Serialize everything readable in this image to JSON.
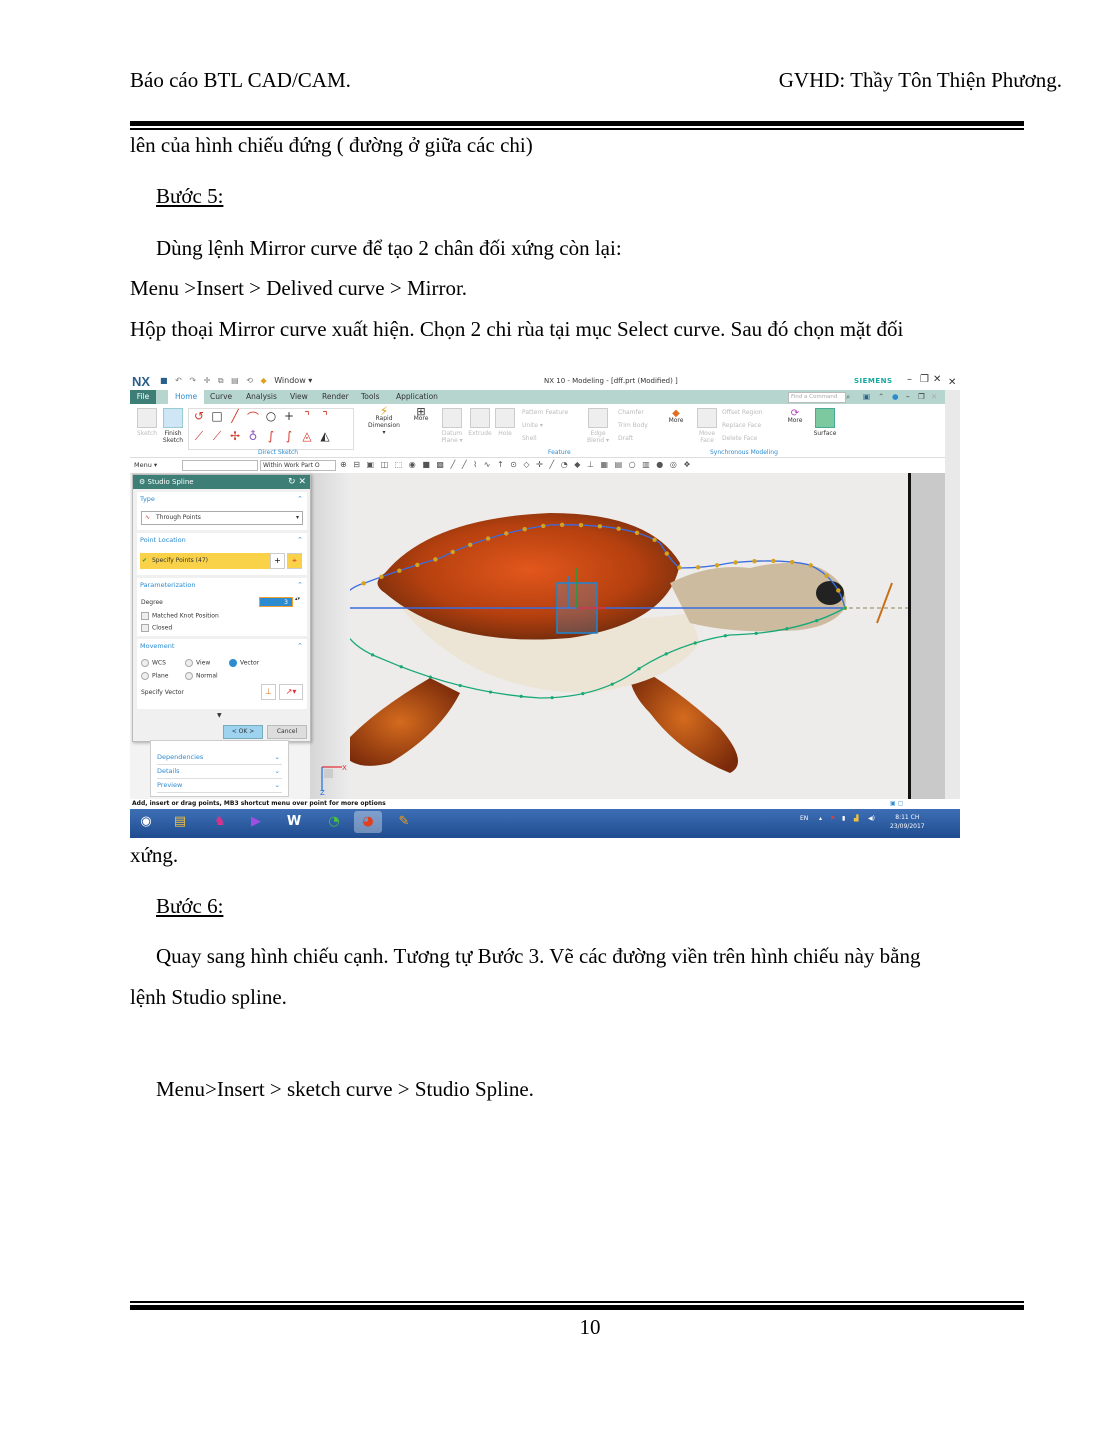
{
  "header": {
    "left": "Báo cáo BTL  CAD/CAM.",
    "right": "GVHD:  Thầy Tôn Thiện Phương."
  },
  "body_text": {
    "continuation": "lên của hình chiếu đứng ( đường ở giữa các chi)",
    "step5_heading": "Bước  5:",
    "step5_p1": "Dùng lệnh Mirror curve để tạo 2 chân đối xứng còn lại:",
    "step5_p2": "Menu >Insert > Delived curve > Mirror.",
    "step5_p3": "Hộp thoại Mirror curve xuất hiện. Chọn 2 chi rùa tại mục Select  curve. Sau đó chọn mặt đối",
    "step5_p3_end": "xứng.",
    "step6_heading": "Bước  6:",
    "step6_p1": "Quay sang hình chiếu cạnh. Tương tự Bước  3. Vẽ các đường viền trên hình chiếu này bằng",
    "step6_p1_end": "lệnh Studio spline.",
    "step6_p2": "Menu>Insert > sketch curve > Studio Spline."
  },
  "footer": {
    "page_number": "10"
  },
  "screenshot": {
    "app": {
      "logo": "NX",
      "window_title": "NX 10 - Modeling - [dff.prt (Modified) ]",
      "brand": "SIEMENS",
      "window_menu": "Window ▾",
      "find_command_placeholder": "Find a Command"
    },
    "ribbon_tabs": [
      "File",
      "Home",
      "Curve",
      "Analysis",
      "View",
      "Render",
      "Tools",
      "Application"
    ],
    "active_tab": "Home",
    "ribbon": {
      "sketch": "Sketch",
      "finish_sketch": "Finish Sketch",
      "direct_sketch_group": "Direct Sketch",
      "rapid_dimension": "Rapid Dimension ▾",
      "more": "More",
      "datum_plane": "Datum Plane ▾",
      "extrude": "Extrude",
      "hole": "Hole",
      "pattern_feature": "Pattern Feature",
      "unite": "Unite ▾",
      "shell": "Shell",
      "edge_blend": "Edge Blend ▾",
      "chamfer": "Chamfer",
      "trim_body": "Trim Body",
      "draft": "Draft",
      "feature_group": "Feature",
      "move_face": "Move Face",
      "offset_region": "Offset Region",
      "replace_face": "Replace Face",
      "delete_face": "Delete Face",
      "sync_group": "Synchronous Modeling",
      "surface": "Surface"
    },
    "command_bar": {
      "menu": "Menu ▾",
      "filter_value": "",
      "scope_value": "Within Work Part O"
    },
    "dialog": {
      "title": "Studio Spline",
      "type_header": "Type",
      "type_value": "Through Points",
      "point_location_header": "Point Location",
      "specify_points": "Specify Points (47)",
      "parameterization_header": "Parameterization",
      "degree_label": "Degree",
      "degree_value": "3",
      "matched_knot": "Matched Knot Position",
      "matched_knot_checked": false,
      "closed": "Closed",
      "closed_checked": false,
      "movement_header": "Movement",
      "movement_options": [
        "WCS",
        "View",
        "Vector",
        "Plane",
        "Normal"
      ],
      "movement_selected": "Vector",
      "specify_vector": "Specify Vector",
      "ok": "< OK >",
      "cancel": "Cancel"
    },
    "subpanel": [
      "Dependencies",
      "Details",
      "Preview"
    ],
    "status_message": "Add, insert or drag points, MB3 shortcut menu over point for more options",
    "taskbar": {
      "language": "EN",
      "time": "8:11 CH",
      "date": "23/09/2017"
    },
    "colors": {
      "nx_teal": "#3d7f77",
      "tab_bar": "#b7d5cf",
      "accent_blue": "#2d8bd0",
      "highlight_yellow": "#f9d249",
      "spline_upper": "#3a6de0",
      "spline_lower": "#18a878",
      "control_point": "#d6a21e"
    }
  }
}
